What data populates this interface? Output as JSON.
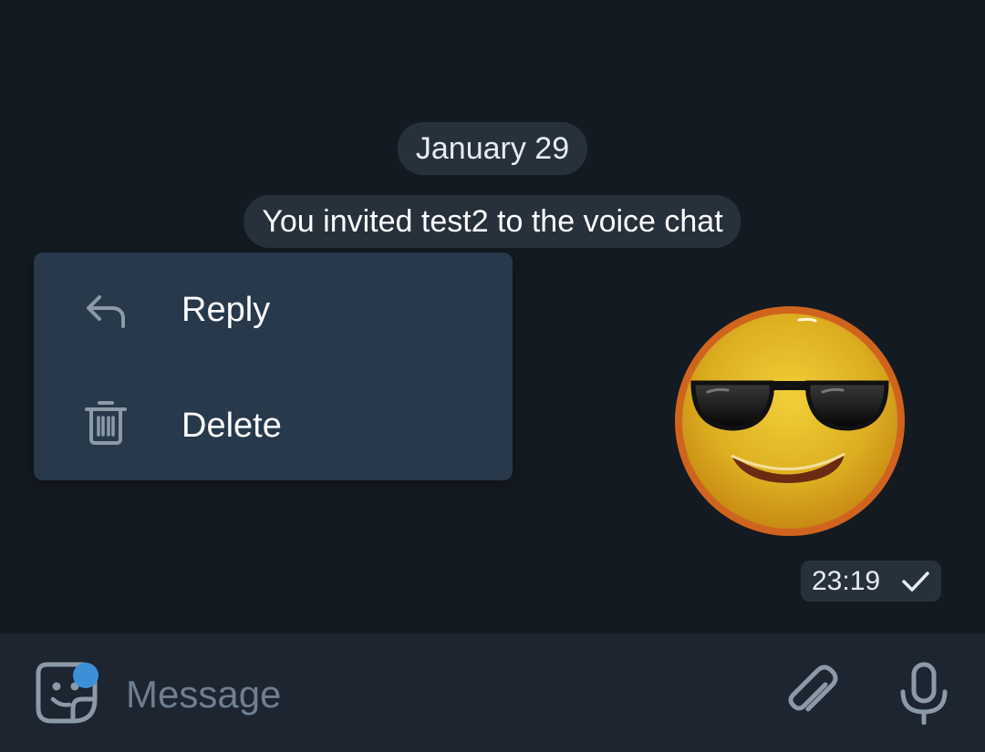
{
  "chat": {
    "date_label": "January 29",
    "service_message": "You invited test2 to the voice chat",
    "sticker": {
      "emoji_name": "smiling-face-with-sunglasses"
    },
    "message_time": "23:19",
    "message_status": "sent"
  },
  "context_menu": {
    "items": [
      {
        "label": "Reply",
        "icon": "reply-icon"
      },
      {
        "label": "Delete",
        "icon": "trash-icon"
      }
    ]
  },
  "composer": {
    "placeholder": "Message",
    "sticker_badge": true
  },
  "colors": {
    "background": "#141a21",
    "pill": "#27313c",
    "menu": "#27394b",
    "composer": "#1c2530",
    "accent": "#3d8fd8",
    "icon": "#8c9aa8"
  }
}
